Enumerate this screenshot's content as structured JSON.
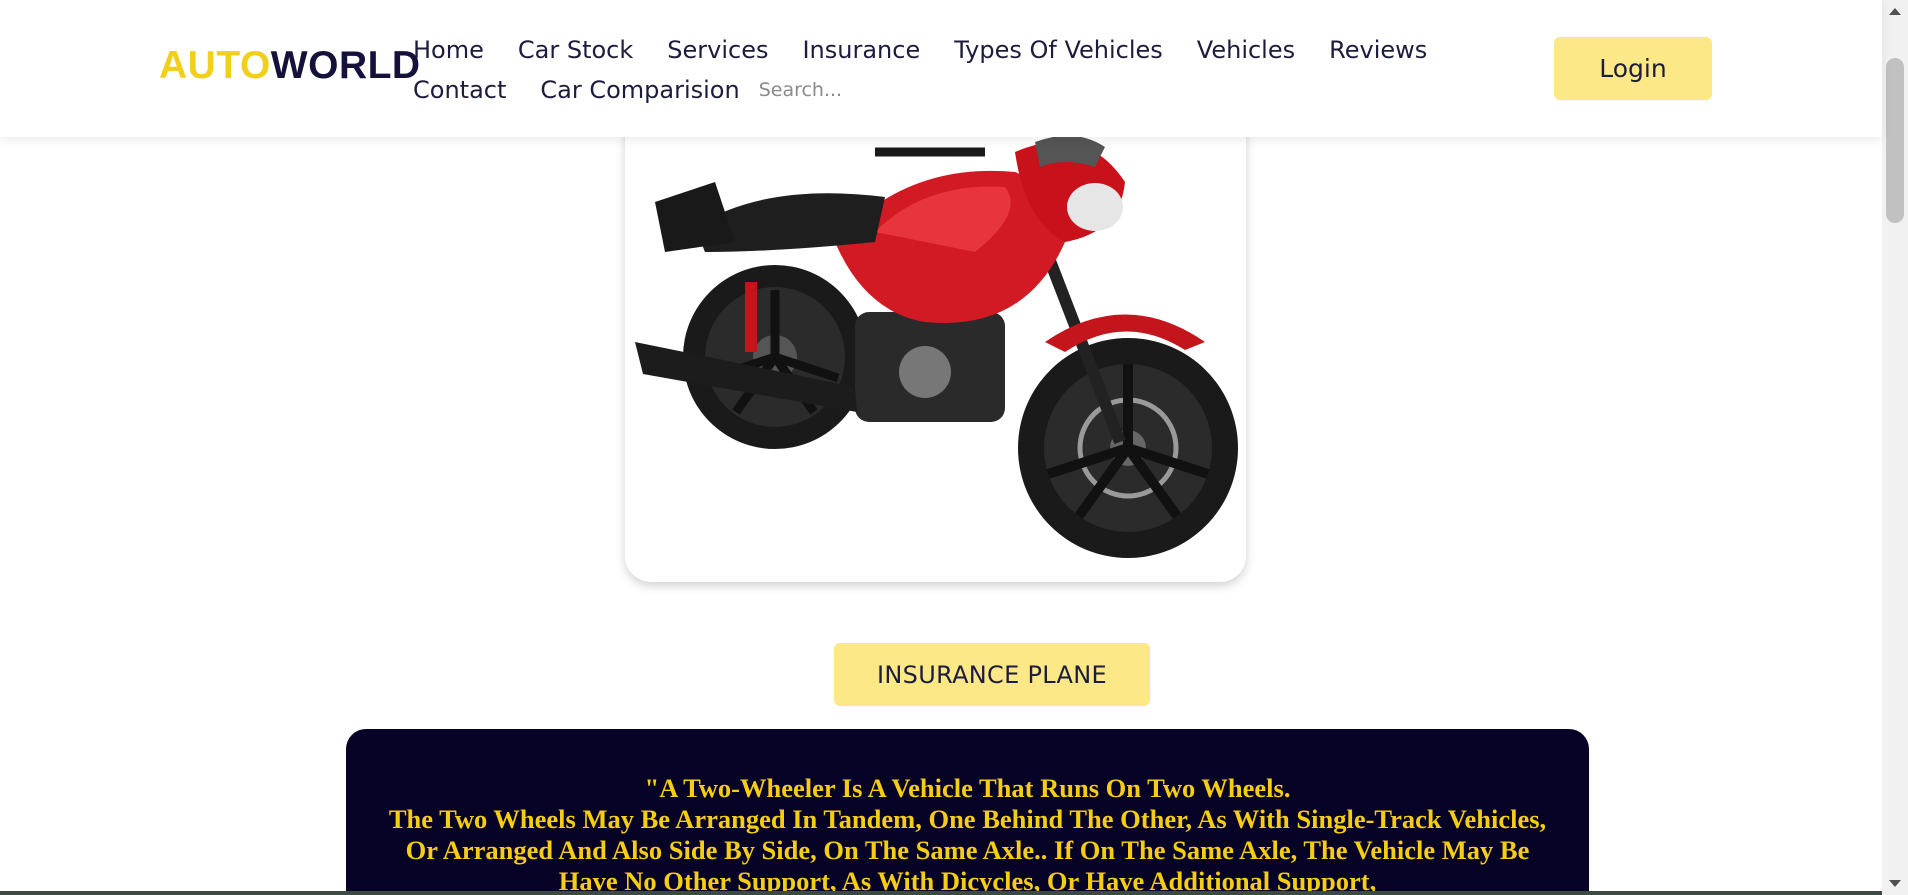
{
  "brand": {
    "part1": "AUTO",
    "part2": "WORLD"
  },
  "nav": {
    "row1": [
      "Home",
      "Car Stock",
      "Services",
      "Insurance",
      "Types Of Vehicles",
      "Vehicles",
      "Reviews"
    ],
    "row2": [
      "Contact",
      "Car Comparision"
    ]
  },
  "search": {
    "placeholder": "Search...",
    "value": ""
  },
  "login_label": "Login",
  "vehicle_image": {
    "alt": "red motorcycle",
    "icon": "motorcycle-image"
  },
  "insurance_button": "INSURANCE PLANE",
  "description": {
    "line1": "\"A Two-Wheeler Is A Vehicle That Runs On Two Wheels.",
    "line2": "The Two Wheels May Be Arranged In Tandem, One Behind The Other, As With Single-Track Vehicles, Or Arranged And Also Side By Side, On The Same Axle.. If On The Same Axle, The Vehicle May Be Have No Other Support, As With Dicycles, Or Have Additional Support,"
  },
  "colors": {
    "brand_yellow": "#f1cf1a",
    "brand_navy": "#14123a",
    "button_yellow": "#fde887",
    "panel_bg": "#070326",
    "panel_text": "#f5cd12"
  }
}
